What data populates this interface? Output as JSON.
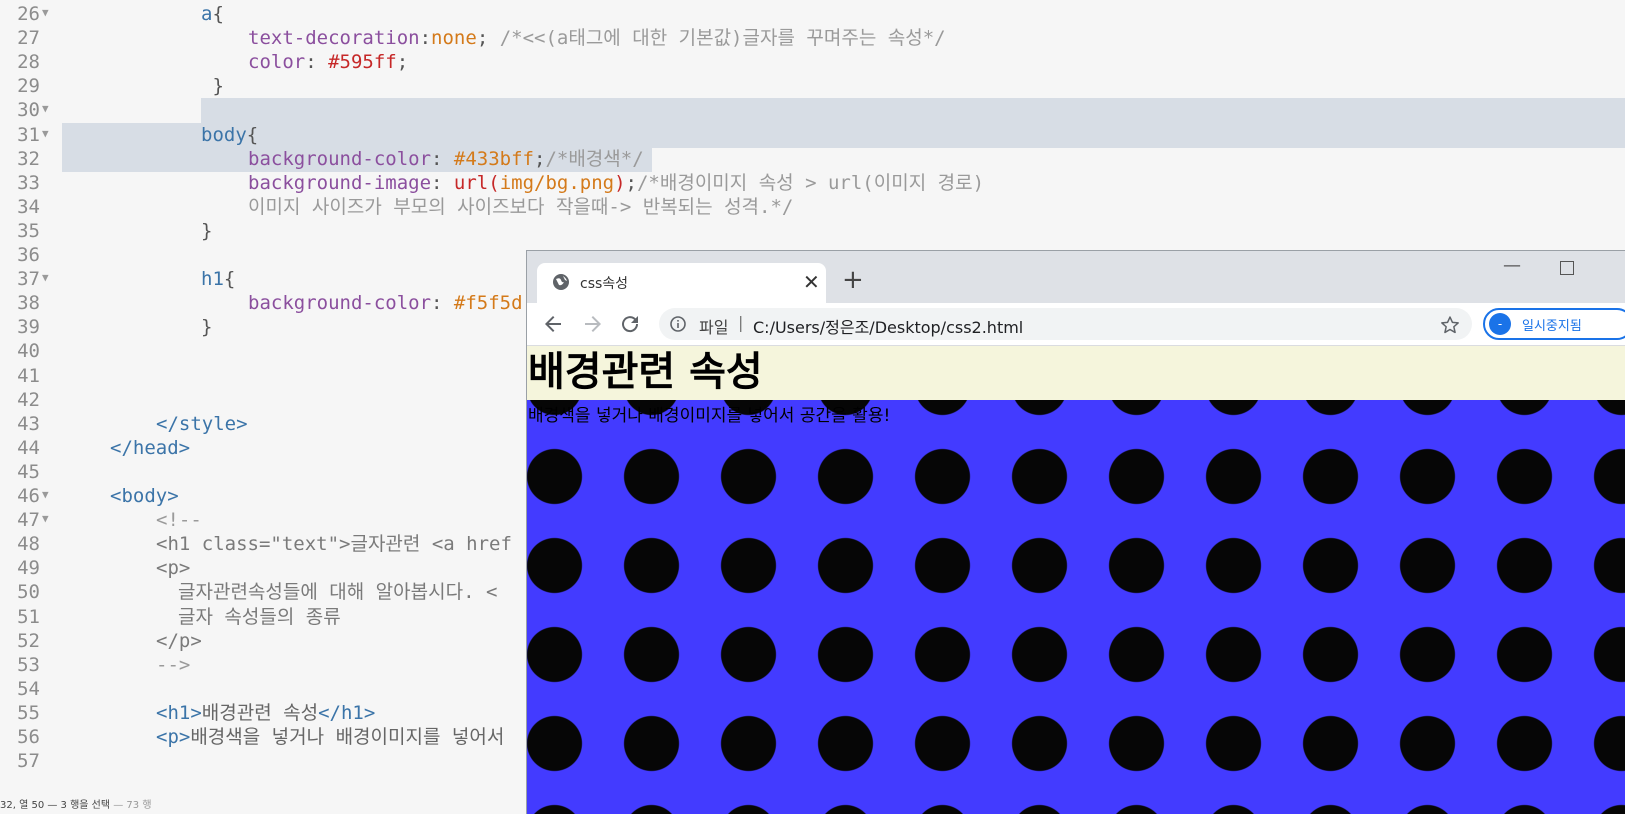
{
  "editor": {
    "lines": [
      {
        "n": "26",
        "fold": true,
        "segs": [
          {
            "t": "a",
            "c": "t-sel"
          },
          {
            "t": "{",
            "c": "t-punc"
          }
        ],
        "indent": 1
      },
      {
        "n": "27",
        "fold": false,
        "segs": [
          {
            "t": "text-decoration",
            "c": "t-prop"
          },
          {
            "t": ":",
            "c": "t-punc"
          },
          {
            "t": "none",
            "c": "t-val"
          },
          {
            "t": "; ",
            "c": "t-punc"
          },
          {
            "t": "/*<<(a태그에 대한 기본값)글자를 꾸며주는 속성*/",
            "c": "t-com"
          }
        ],
        "indent": 2
      },
      {
        "n": "28",
        "fold": false,
        "segs": [
          {
            "t": "color",
            "c": "t-prop"
          },
          {
            "t": ": ",
            "c": "t-punc"
          },
          {
            "t": "#595ff",
            "c": "t-red"
          },
          {
            "t": ";",
            "c": "t-punc"
          }
        ],
        "indent": 2
      },
      {
        "n": "29",
        "fold": false,
        "segs": [
          {
            "t": " }",
            "c": "t-punc"
          }
        ],
        "indent": 1
      },
      {
        "n": "30",
        "fold": true,
        "segs": [],
        "indent": 1
      },
      {
        "n": "31",
        "fold": true,
        "segs": [
          {
            "t": "body",
            "c": "t-sel"
          },
          {
            "t": "{",
            "c": "t-punc"
          }
        ],
        "indent": 1
      },
      {
        "n": "32",
        "fold": false,
        "segs": [
          {
            "t": "background-color",
            "c": "t-prop"
          },
          {
            "t": ": ",
            "c": "t-punc"
          },
          {
            "t": "#433bff",
            "c": "t-val"
          },
          {
            "t": ";",
            "c": "t-punc"
          },
          {
            "t": "/*배경색*/",
            "c": "t-com"
          }
        ],
        "indent": 2
      },
      {
        "n": "33",
        "fold": false,
        "segs": [
          {
            "t": "background-image",
            "c": "t-prop"
          },
          {
            "t": ": ",
            "c": "t-punc"
          },
          {
            "t": "url(",
            "c": "t-red"
          },
          {
            "t": "img/bg.png",
            "c": "t-val"
          },
          {
            "t": ")",
            "c": "t-red"
          },
          {
            "t": ";",
            "c": "t-punc"
          },
          {
            "t": "/*배경이미지 속성 > url(이미지 경로)",
            "c": "t-com"
          }
        ],
        "indent": 2
      },
      {
        "n": "34",
        "fold": false,
        "segs": [
          {
            "t": "이미지 사이즈가 부모의 사이즈보다 작을때-> 반복되는 성격.*/",
            "c": "t-com"
          }
        ],
        "indent": 2
      },
      {
        "n": "35",
        "fold": false,
        "segs": [
          {
            "t": "}",
            "c": "t-punc"
          }
        ],
        "indent": 1
      },
      {
        "n": "36",
        "fold": false,
        "segs": [],
        "indent": 1
      },
      {
        "n": "37",
        "fold": true,
        "segs": [
          {
            "t": "h1",
            "c": "t-sel"
          },
          {
            "t": "{",
            "c": "t-punc"
          }
        ],
        "indent": 1
      },
      {
        "n": "38",
        "fold": false,
        "segs": [
          {
            "t": "background-color",
            "c": "t-prop"
          },
          {
            "t": ": ",
            "c": "t-punc"
          },
          {
            "t": "#f5f5d",
            "c": "t-val"
          }
        ],
        "indent": 2
      },
      {
        "n": "39",
        "fold": false,
        "segs": [
          {
            "t": "}",
            "c": "t-punc"
          }
        ],
        "indent": 1
      },
      {
        "n": "40",
        "fold": false,
        "segs": [],
        "indent": 1
      },
      {
        "n": "41",
        "fold": false,
        "segs": [],
        "indent": 1
      },
      {
        "n": "42",
        "fold": false,
        "segs": [],
        "indent": 1
      },
      {
        "n": "43",
        "fold": false,
        "segs": [
          {
            "t": "</style>",
            "c": "t-tag"
          }
        ],
        "indent": 0.5
      },
      {
        "n": "44",
        "fold": false,
        "segs": [
          {
            "t": "</head>",
            "c": "t-tag"
          }
        ],
        "indent": 0
      },
      {
        "n": "45",
        "fold": false,
        "segs": [],
        "indent": 0
      },
      {
        "n": "46",
        "fold": true,
        "segs": [
          {
            "t": "<body>",
            "c": "t-tag"
          }
        ],
        "indent": 0
      },
      {
        "n": "47",
        "fold": true,
        "segs": [
          {
            "t": "<!--",
            "c": "t-com"
          }
        ],
        "indent": 0.5
      },
      {
        "n": "48",
        "fold": false,
        "segs": [
          {
            "t": "<h1 class=\"text\">글자관련 <a href",
            "c": "t-attr"
          }
        ],
        "indent": 0.5
      },
      {
        "n": "49",
        "fold": false,
        "segs": [
          {
            "t": "<p>",
            "c": "t-attr"
          }
        ],
        "indent": 0.5
      },
      {
        "n": "50",
        "fold": false,
        "segs": [
          {
            "t": "글자관련속성들에 대해 알아봅시다. <",
            "c": "t-attr"
          }
        ],
        "indent": 0.75
      },
      {
        "n": "51",
        "fold": false,
        "segs": [
          {
            "t": "글자 속성들의 종류",
            "c": "t-attr"
          }
        ],
        "indent": 0.75
      },
      {
        "n": "52",
        "fold": false,
        "segs": [
          {
            "t": "</p>",
            "c": "t-attr"
          }
        ],
        "indent": 0.5
      },
      {
        "n": "53",
        "fold": false,
        "segs": [
          {
            "t": "-->",
            "c": "t-com"
          }
        ],
        "indent": 0.5
      },
      {
        "n": "54",
        "fold": false,
        "segs": [],
        "indent": 0.5
      },
      {
        "n": "55",
        "fold": false,
        "segs": [
          {
            "t": "<h1>",
            "c": "t-tag"
          },
          {
            "t": "배경관련 속성",
            "c": "t-txt"
          },
          {
            "t": "</h1>",
            "c": "t-tag"
          }
        ],
        "indent": 0.5
      },
      {
        "n": "56",
        "fold": false,
        "segs": [
          {
            "t": "<p>",
            "c": "t-tag"
          },
          {
            "t": "배경색을 넣거나 배경이미지를 넣어서",
            "c": "t-txt"
          }
        ],
        "indent": 0.5
      },
      {
        "n": "57",
        "fold": false,
        "segs": [],
        "indent": 0.5
      }
    ]
  },
  "statusbar": {
    "position": "32, 열 50 — 3 행을 선택",
    "total": " — 73 행"
  },
  "browser": {
    "tab_title": "css속성",
    "tab_close": "✕",
    "new_tab": "+",
    "minimize": "—",
    "omnibox_scheme": "파일",
    "omnibox_sep": "|",
    "url": "C:/Users/정은조/Desktop/css2.html",
    "pause_label": "일시중지됨",
    "pause_icon": "-",
    "icons": {
      "back": "arrow-left-icon",
      "forward": "arrow-right-icon",
      "reload": "reload-icon",
      "info": "info-icon",
      "star": "star-icon",
      "globe": "globe-icon"
    }
  },
  "page": {
    "h1": "배경관련 속성",
    "p": "배경색을 넣거나 배경이미지를 넣어서 공간을 활용!",
    "colors": {
      "body_bg": "#433bff",
      "h1_bg": "#f5f5dc",
      "dot": "#060606"
    }
  }
}
